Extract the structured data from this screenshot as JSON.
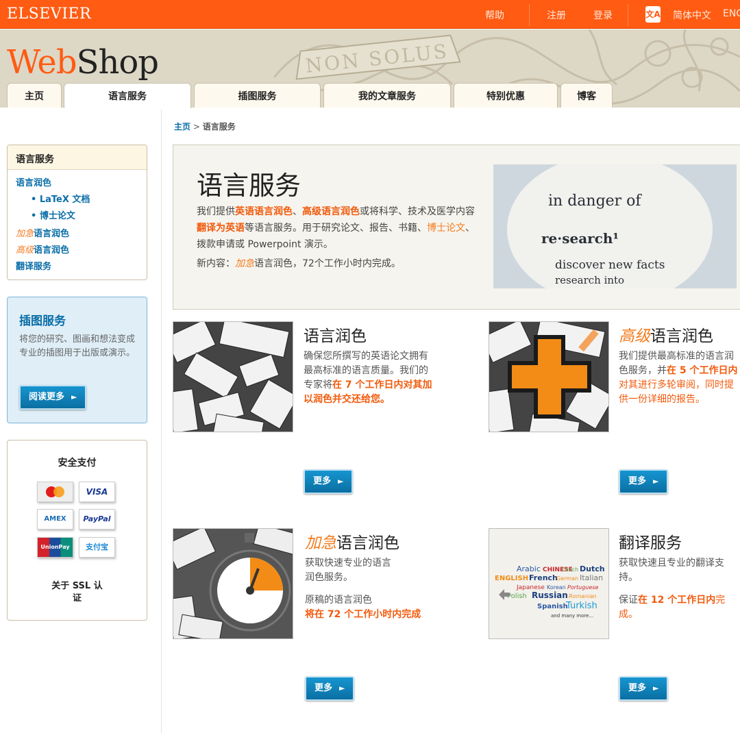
{
  "topbar": {
    "brand": "ELSEVIER",
    "help": "帮助",
    "register": "注册",
    "login": "登录",
    "lang_icon": "文A",
    "lang_zh": "简体中文",
    "lang_en": "ENG"
  },
  "header": {
    "logo_web": "Web",
    "logo_shop": "Shop",
    "motto": "NON SOLUS"
  },
  "tabs": [
    "主页",
    "语言服务",
    "插图服务",
    "我的文章服务",
    "特别优惠",
    "博客"
  ],
  "sidebar": {
    "lang": {
      "title": "语言服务",
      "items": [
        "语言润色",
        "• LaTeX 文档",
        "• 博士论文"
      ],
      "urgent_prefix": "加急",
      "urgent_suffix": "语言润色",
      "advanced_prefix": "高级",
      "advanced_suffix": "语言润色",
      "translate": "翻译服务"
    },
    "illus": {
      "title": "插图服务",
      "desc": "将您的研究、图画和想法变成专业的插图用于出版或演示。",
      "button": "阅读更多"
    },
    "payment": {
      "title": "安全支付",
      "cards": [
        "MasterCard",
        "VISA",
        "AMEX",
        "PayPal",
        "UnionPay",
        "支付宝"
      ],
      "ssl_line1": "关于 SSL 认",
      "ssl_line2": "证"
    }
  },
  "breadcrumb": {
    "home": "主页",
    "sep": " > ",
    "current": "语言服务"
  },
  "hero": {
    "title": "语言服务",
    "p1": "我们提供",
    "b1": "英语语言润色",
    "p2": "、",
    "b2": "高级语言润色",
    "p3": "或将科学、技术及医学内容",
    "b3": "翻译为英语",
    "p4": "等语言服务。用于研究论文、报告、书籍、",
    "o1": "博士论文",
    "p5": "、拨款申请或 Powerpoint 演示。",
    "new_label": "新内容：",
    "new_o": "加急",
    "new_rest": "语言润色，72个工作小时内完成。",
    "image_text1": "in danger of",
    "image_text2": "re·search¹",
    "image_text3": "discover new facts",
    "image_text4": "research into"
  },
  "services": {
    "polish": {
      "title": "语言润色",
      "d1": "确保您所撰写的英语论文拥有最高标准的语言质量。我们的专家将",
      "b1": "在 7 个工作日内",
      "b2": "对其加以润色并交还给您。",
      "button": "更多"
    },
    "advanced": {
      "title_o": "高级",
      "title": "语言润色",
      "d1": "我们提供最高标准的语言润色服务，并",
      "b1": "在 5 个工作日内",
      "b2": "对其进行多轮审阅，同时提供一份详细的报告。",
      "button": "更多"
    },
    "urgent": {
      "title_o": "加急",
      "title": "语言润色",
      "d1": "获取快速专业的语言润色服务。",
      "d2": "原稿的语言润色",
      "b1": "将在 72 个工作小时内完成",
      "button": "更多"
    },
    "translate": {
      "title": "翻译服务",
      "d1": "获取快速且专业的翻译支持。",
      "d2": "保证",
      "b1": "在 12 个工作日内",
      "d3": "完成。",
      "langs": [
        "Arabic",
        "CHINESE",
        "Czech",
        "Dutch",
        "ENGLISH",
        "French",
        "German",
        "Italian",
        "Japanese",
        "Korean",
        "Portuguese",
        "Polish",
        "Russian",
        "Romanian",
        "Spanish",
        "Turkish",
        "and many more..."
      ],
      "button": "更多"
    }
  },
  "colors": {
    "orange": "#ff5b12",
    "blue": "#0b6ea8",
    "button": "#0a80bb"
  }
}
